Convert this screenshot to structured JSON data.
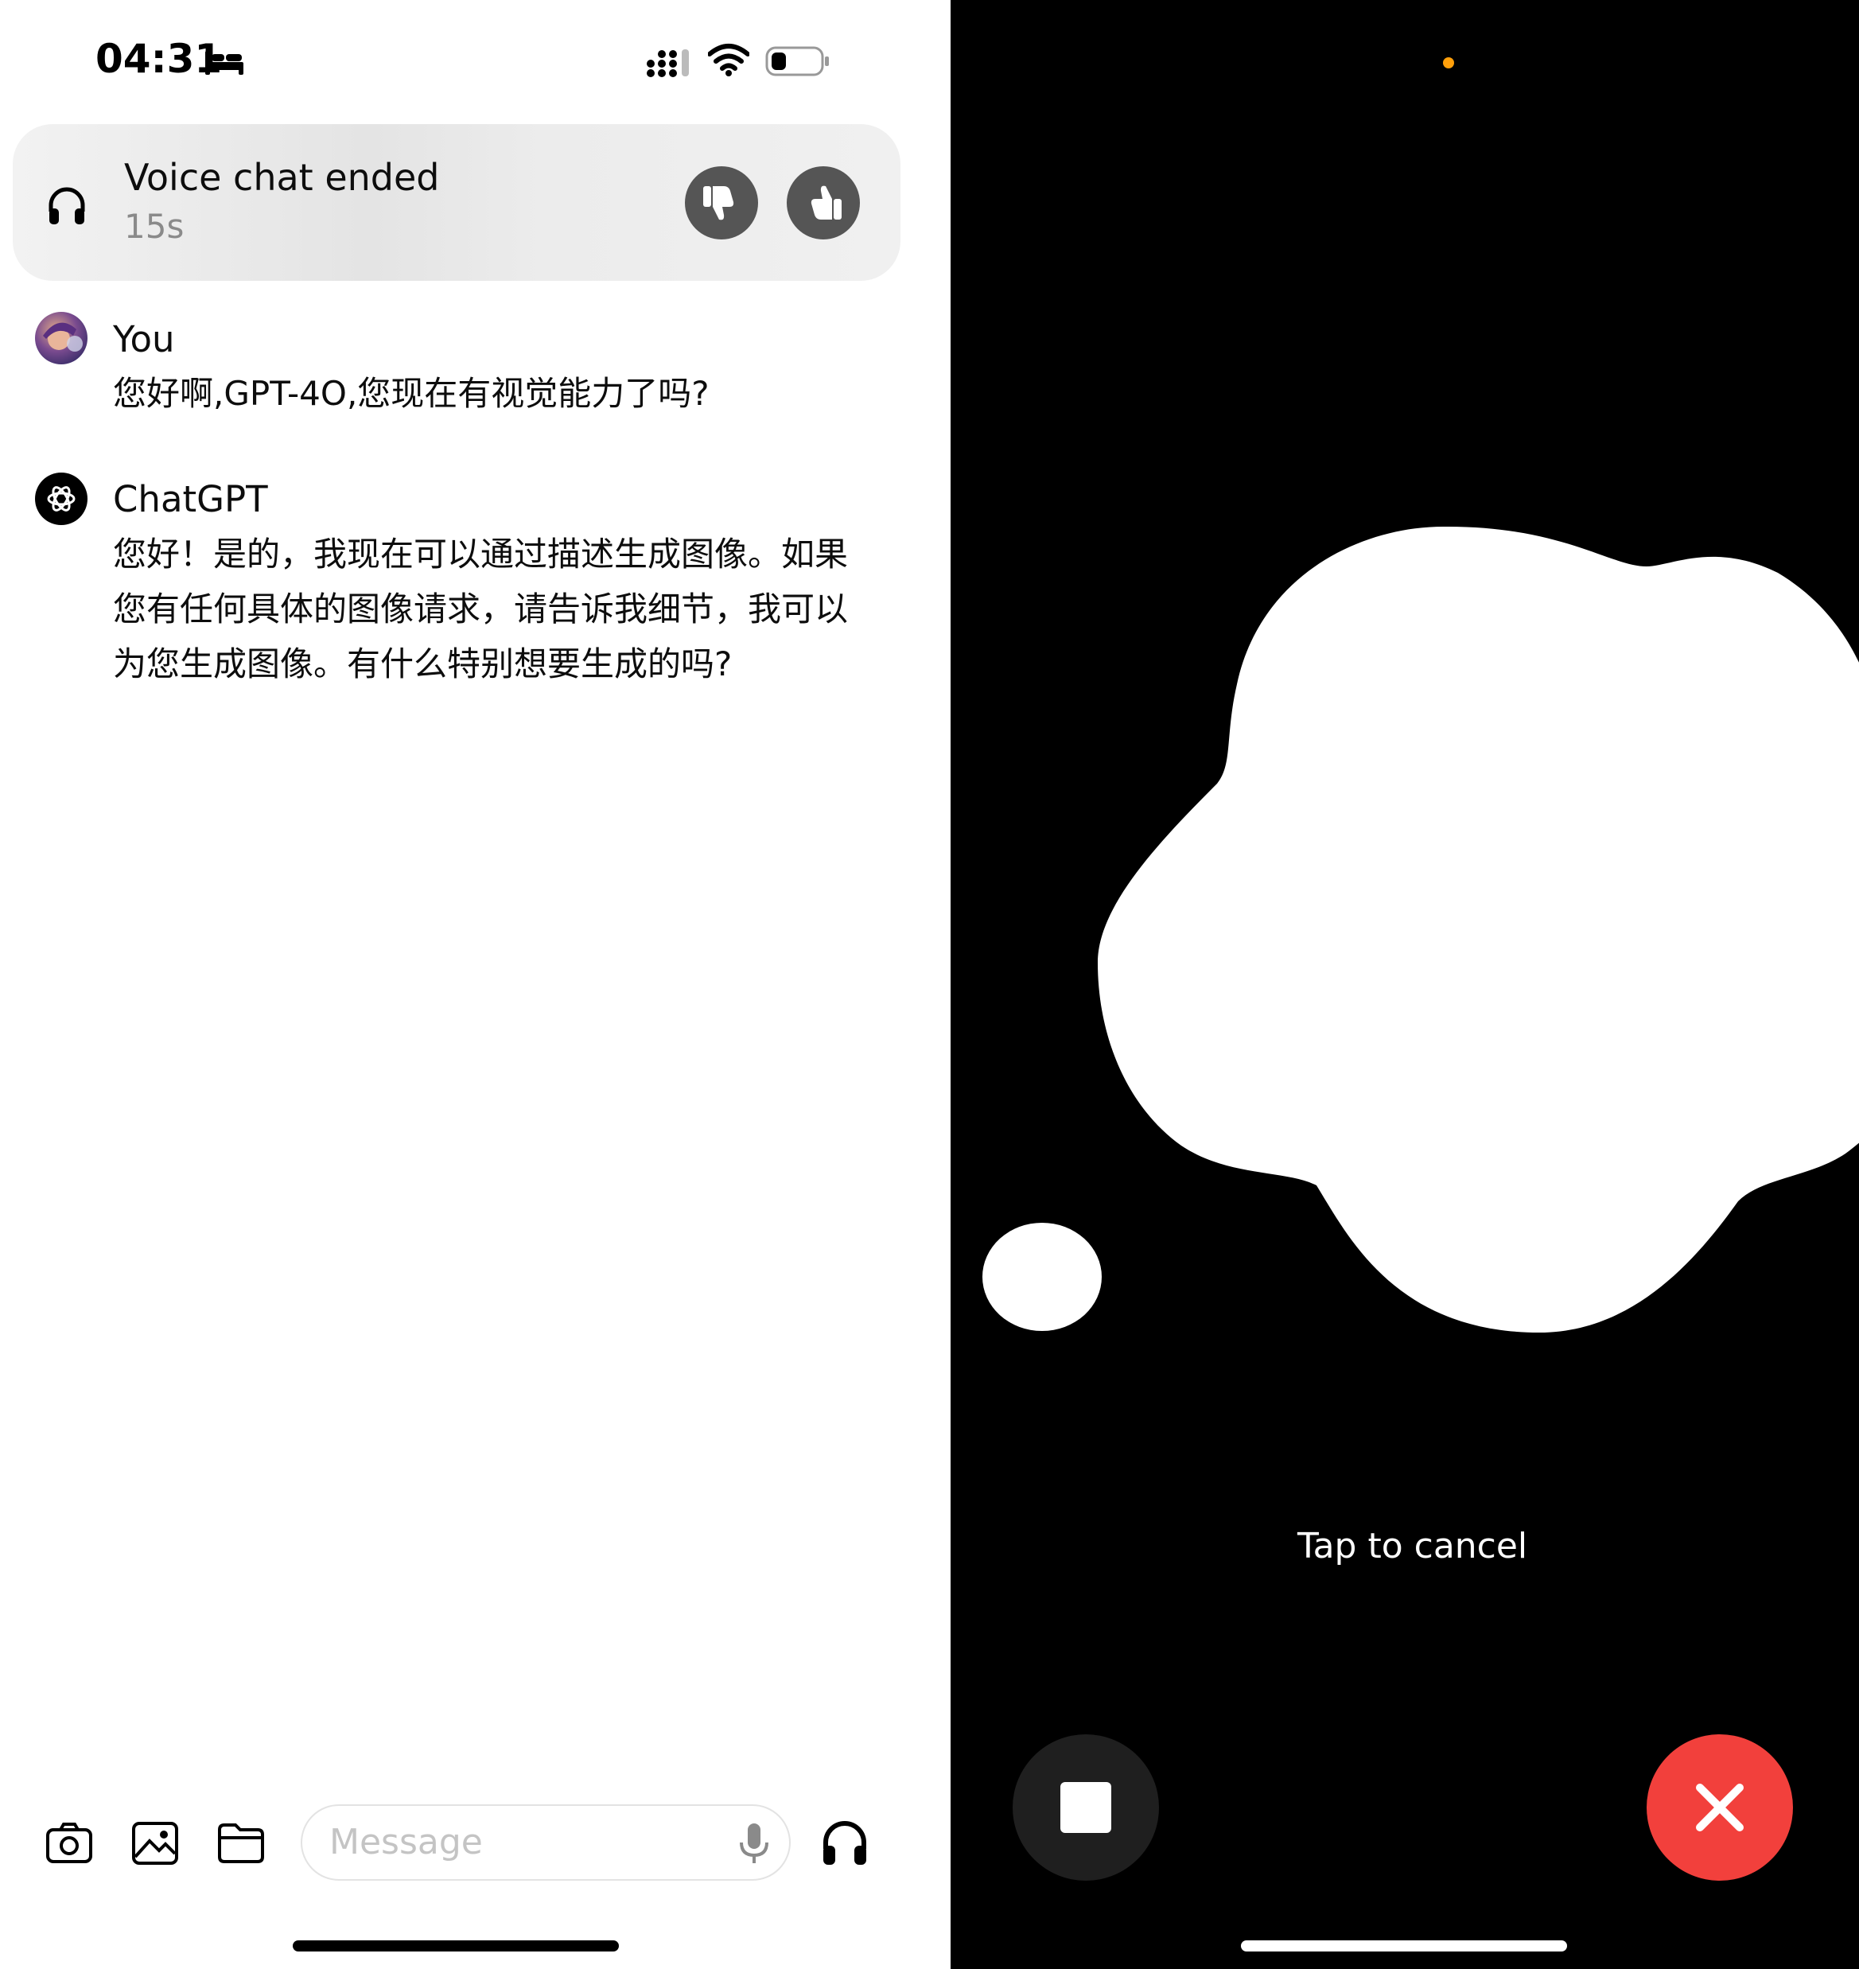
{
  "status_bar": {
    "time": "04:31",
    "icons": [
      "sleep-bed-icon",
      "cellular-signal-icon",
      "wifi-icon",
      "battery-icon"
    ]
  },
  "voice_banner": {
    "title": "Voice chat ended",
    "duration": "15s",
    "icons": [
      "headphones-icon",
      "thumbs-down-icon",
      "thumbs-up-icon"
    ]
  },
  "conversation": [
    {
      "sender": "You",
      "text": "您好啊,GPT-4O,您现在有视觉能力了吗?"
    },
    {
      "sender": "ChatGPT",
      "text": "您好！是的，我现在可以通过描述生成图像。如果您有任何具体的图像请求，请告诉我细节，我可以为您生成图像。有什么特别想要生成的吗?"
    }
  ],
  "composer": {
    "placeholder": "Message",
    "tools": [
      "camera-icon",
      "image-icon",
      "folder-icon",
      "microphone-icon",
      "headphones-icon"
    ]
  },
  "voice_mode": {
    "hint": "Tap to cancel",
    "buttons": [
      "stop-icon",
      "close-icon"
    ],
    "colors": {
      "background": "#000000",
      "blob": "#ffffff",
      "cancel": "#f2403c",
      "recording_dot": "#ff9f0a"
    }
  }
}
